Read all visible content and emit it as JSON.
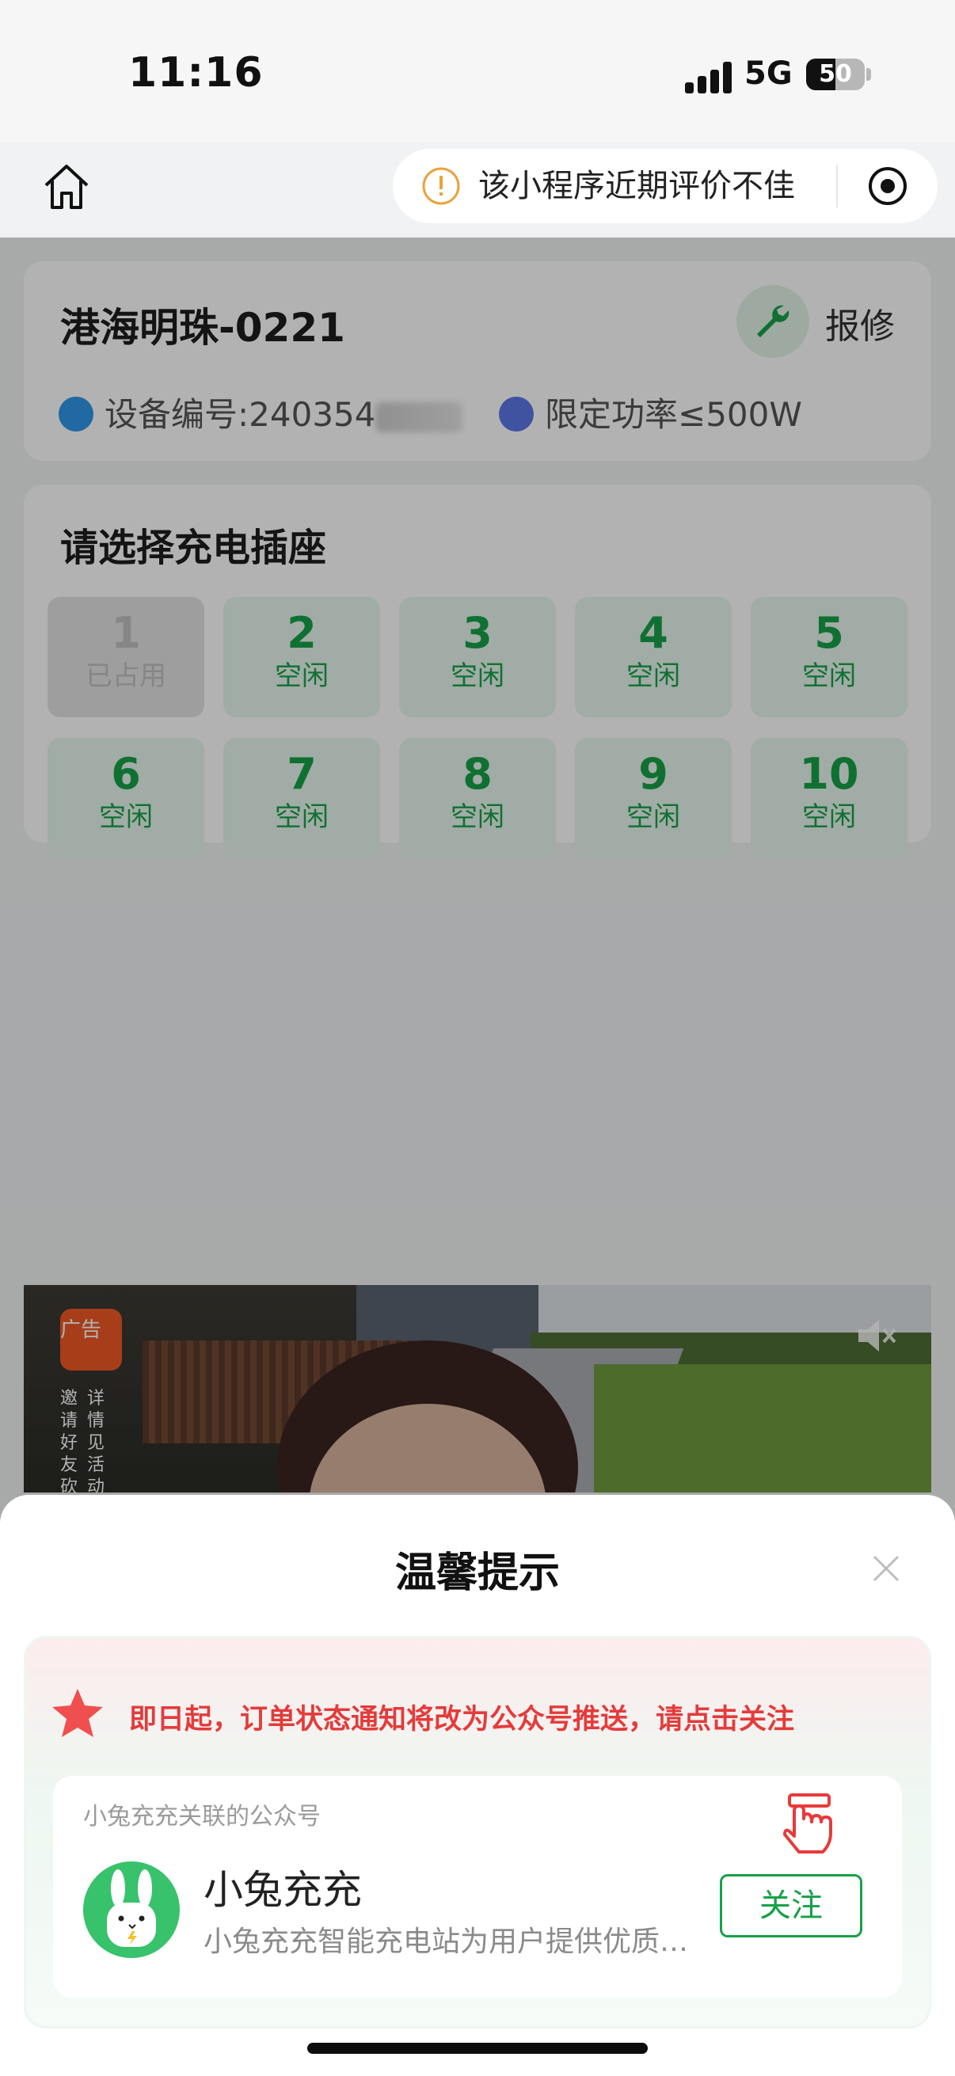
{
  "status_bar": {
    "time": "11:16",
    "network": "5G",
    "battery": "50",
    "battery_level": 0.5
  },
  "nav": {
    "capsule_text": "该小程序近期评价不佳"
  },
  "device": {
    "station_name": "港海明珠-0221",
    "repair_label": "报修",
    "device_no_label": "设备编号:240354",
    "power_limit": "限定功率≤500W"
  },
  "socket_section": {
    "title": "请选择充电插座",
    "sockets": [
      {
        "num": "1",
        "status": "已占用"
      },
      {
        "num": "2",
        "status": "空闲"
      },
      {
        "num": "3",
        "status": "空闲"
      },
      {
        "num": "4",
        "status": "空闲"
      },
      {
        "num": "5",
        "status": "空闲"
      },
      {
        "num": "6",
        "status": "空闲"
      },
      {
        "num": "7",
        "status": "空闲"
      },
      {
        "num": "8",
        "status": "空闲"
      },
      {
        "num": "9",
        "status": "空闲"
      },
      {
        "num": "10",
        "status": "空闲"
      }
    ]
  },
  "ad": {
    "tag": "广告",
    "text_left": "邀请好友砍",
    "text_right": "详情见活动"
  },
  "sheet": {
    "title": "温馨提示",
    "notice": "即日起，订单状态通知将改为公众号推送，请点击关注",
    "account_caption": "小兔充充关联的公众号",
    "account_name": "小兔充充",
    "account_desc": "小兔充充智能充电站为用户提供优质…",
    "follow_label": "关注"
  },
  "colors": {
    "accent_green": "#17a148",
    "notice_red": "#e43b3b",
    "socket_free_bg": "#e6f7ec"
  }
}
